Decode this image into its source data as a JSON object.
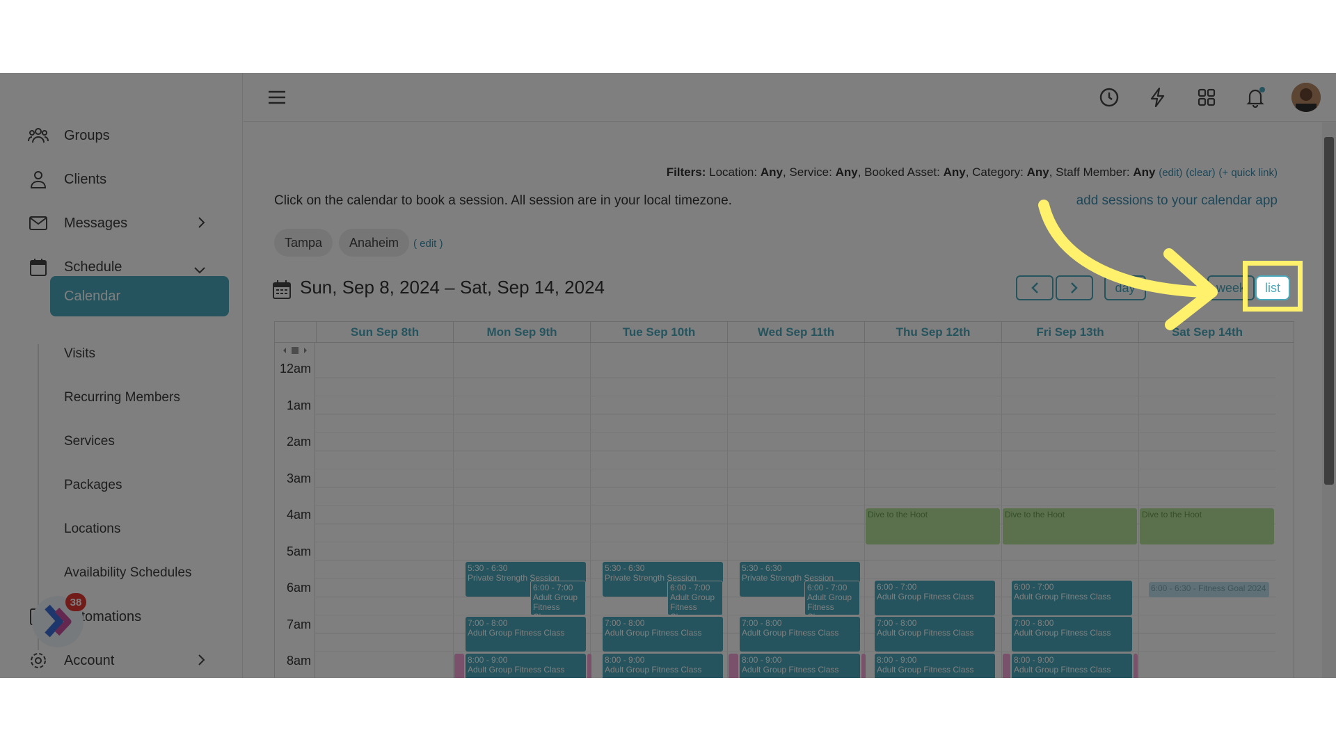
{
  "sidebar": {
    "items": [
      {
        "label": "Groups",
        "icon": "groups-icon"
      },
      {
        "label": "Clients",
        "icon": "user-icon"
      },
      {
        "label": "Messages",
        "icon": "mail-icon"
      },
      {
        "label": "Schedule",
        "icon": "calendar-icon"
      }
    ],
    "schedule_sub": [
      "Calendar",
      "Visits",
      "Recurring Members",
      "Services",
      "Packages",
      "Locations",
      "Availability Schedules"
    ],
    "bottom_items": [
      {
        "label": "Automations",
        "icon": "checkbox-icon"
      },
      {
        "label": "Account",
        "icon": "gear-icon"
      }
    ],
    "badge_count": "38"
  },
  "filters": {
    "label": "Filters:",
    "location_label": "Location:",
    "location": "Any",
    "service_label": "Service:",
    "service": "Any",
    "asset_label": "Booked Asset:",
    "asset": "Any",
    "category_label": "Category:",
    "category": "Any",
    "staff_label": "Staff Member:",
    "staff": "Any",
    "edit": "(edit)",
    "clear": "(clear)",
    "quick_link": "(+ quick link)"
  },
  "instructions": "Click on the calendar to book a session. All session are in your local timezone.",
  "add_sessions_link": "add sessions to your calendar app",
  "locations": [
    "Tampa",
    "Anaheim"
  ],
  "locations_edit": "( edit )",
  "date_range": "Sun, Sep 8, 2024 – Sat, Sep 14, 2024",
  "view_buttons": {
    "day": "day",
    "week": "week",
    "list": "list"
  },
  "days": [
    "Sun Sep 8th",
    "Mon Sep 9th",
    "Tue Sep 10th",
    "Wed Sep 11th",
    "Thu Sep 12th",
    "Fri Sep 13th",
    "Sat Sep 14th"
  ],
  "hours": [
    "12am",
    "1am",
    "2am",
    "3am",
    "4am",
    "5am",
    "6am",
    "7am",
    "8am"
  ],
  "events": {
    "dive": "Dive to the Hoot",
    "private_time": "5:30 - 6:30",
    "private_title": "Private Strength Session",
    "six_time": "6:00 - 7:00",
    "agfc": "Adult Group Fitness Class",
    "seven_time": "7:00 - 8:00",
    "eight_time": "8:00 - 9:00",
    "sat_six": "6:00 - 6:30 - Fitness Goal 2024"
  },
  "colors": {
    "accent": "#4aa9bc",
    "highlight": "#fff16b",
    "badge": "#e53935"
  }
}
